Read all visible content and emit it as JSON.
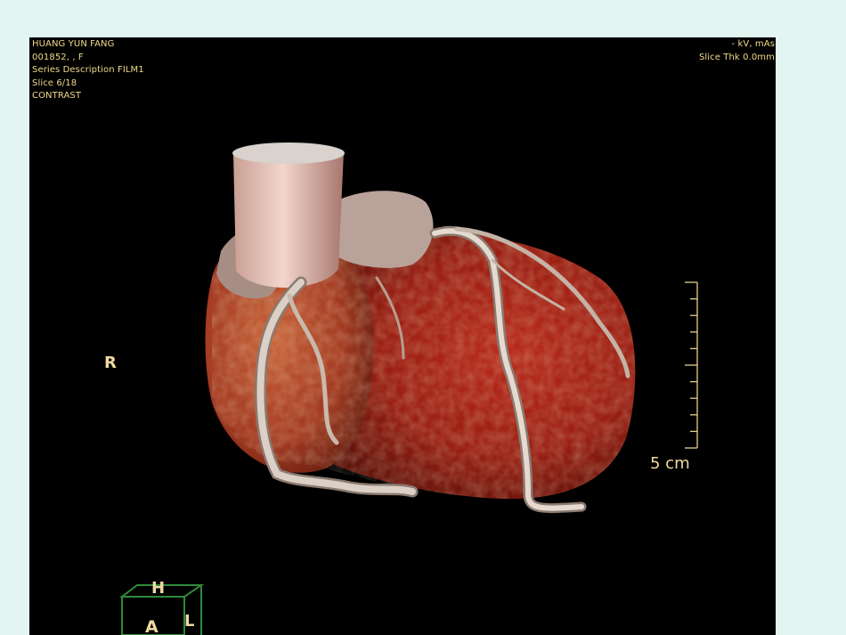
{
  "patient": {
    "name": "HUANG YUN FANG",
    "id_line": "001852, , F",
    "series_description": "Series Description FILM1",
    "slice": "Slice 6/18",
    "contrast": "CONTRAST"
  },
  "acquisition": {
    "kv_mas": "- kV, mAs",
    "slice_thickness": "Slice Thk 0.0mm"
  },
  "orientation": {
    "left_marker": "R",
    "cube_top": "H",
    "cube_front": "A",
    "cube_side": "L"
  },
  "scale_bar": {
    "label": "5 cm",
    "tick_count": 10
  },
  "colors": {
    "overlay_text": "#f1d98a",
    "viewport_bg": "#000000",
    "page_bg": "#e3f5f1",
    "myocardium": "#a32418",
    "vessel": "#d9c9bd",
    "orientation_cube": "#2f8a3a"
  }
}
